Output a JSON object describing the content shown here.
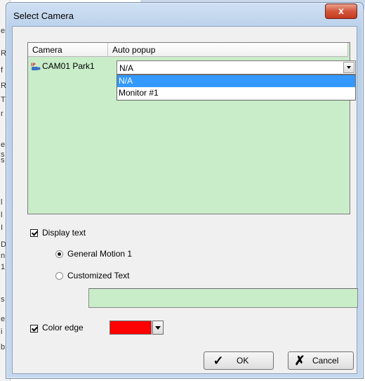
{
  "background": {
    "edge_chars": [
      "e",
      "R",
      "f",
      "R",
      "T",
      "r",
      "e",
      "s",
      "s",
      "l",
      "l",
      "I",
      "D",
      "n",
      "1",
      "s",
      "e",
      "i",
      "b"
    ]
  },
  "dialog": {
    "title": "Select Camera",
    "close_glyph": "x",
    "list": {
      "columns": [
        "Camera",
        "Auto popup"
      ],
      "rows": [
        {
          "icon": "ip-camera-icon",
          "camera": "CAM01 Park1",
          "auto_popup": "N/A"
        }
      ],
      "dropdown_options": [
        "N/A",
        "Monitor #1"
      ],
      "dropdown_selected_index": 0
    },
    "display_text": {
      "label": "Display text",
      "checked": true,
      "options": [
        {
          "label": "General Motion 1",
          "selected": true
        },
        {
          "label": "Customized Text",
          "selected": false
        }
      ],
      "custom_text_value": ""
    },
    "color_edge": {
      "label": "Color edge",
      "checked": true,
      "color": "#ff0000"
    },
    "buttons": {
      "ok": "OK",
      "cancel": "Cancel"
    }
  },
  "colors": {
    "list_background": "#c9ecc9",
    "selection": "#3399ff",
    "close_button": "#c43a20"
  }
}
